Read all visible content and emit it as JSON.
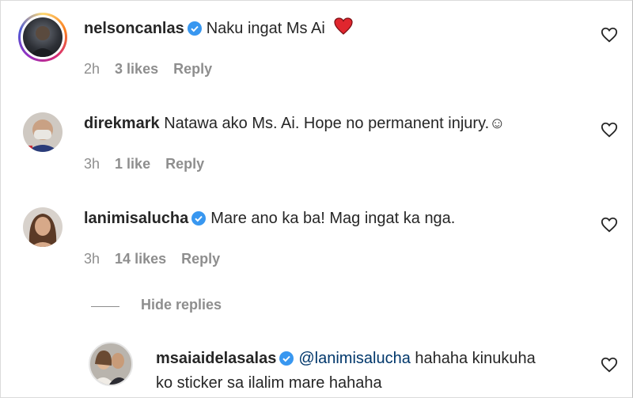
{
  "comments": [
    {
      "username": "nelsoncanlas",
      "verified": true,
      "text": "Naku ingat Ms Ai",
      "emoji": "heart",
      "time": "2h",
      "likes": "3 likes",
      "reply": "Reply"
    },
    {
      "username": "direkmark",
      "verified": false,
      "text": "Natawa ako Ms. Ai. Hope no permanent injury.☺",
      "time": "3h",
      "likes": "1 like",
      "reply": "Reply"
    },
    {
      "username": "lanimisalucha",
      "verified": true,
      "text": "Mare ano ka ba! Mag ingat ka nga.",
      "time": "3h",
      "likes": "14 likes",
      "reply": "Reply"
    }
  ],
  "hide_replies": "Hide replies",
  "reply_comment": {
    "username": "msaiaidelasalas",
    "verified": true,
    "mention": "@lanimisalucha",
    "text_line1": "hahaha kinukuha",
    "text_line2": "ko sticker sa ilalim mare hahaha"
  },
  "colors": {
    "verified_blue": "#3897f0",
    "mention": "#00376b",
    "muted": "#8e8e8e",
    "heart_red": "#ed4956"
  }
}
